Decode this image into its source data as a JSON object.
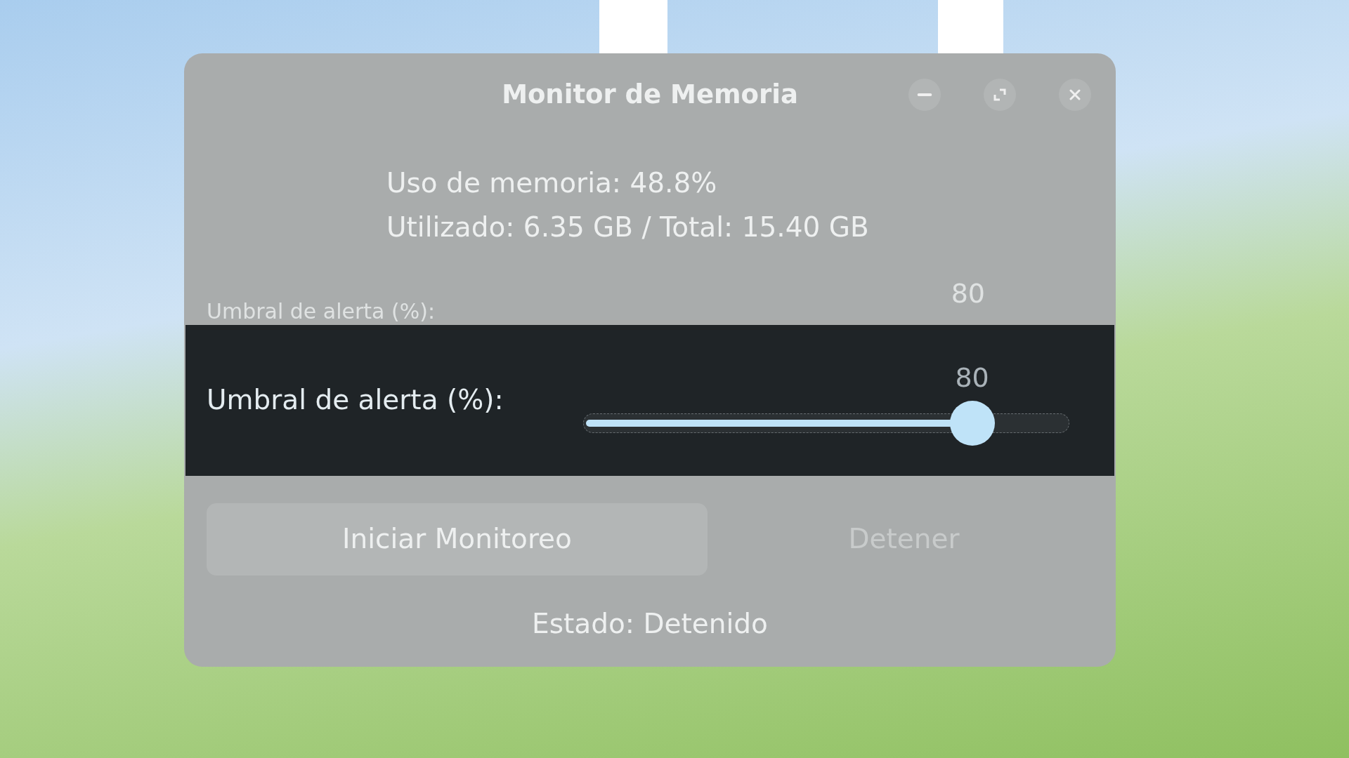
{
  "window": {
    "title": "Monitor de Memoria"
  },
  "memory": {
    "usage": "Uso de memoria: 48.8%",
    "detail": "Utilizado: 6.35 GB / Total: 15.40 GB"
  },
  "threshold_behind": {
    "label": "Umbral de alerta (%):",
    "value": "80"
  },
  "threshold": {
    "label": "Umbral de alerta (%):",
    "value": "80",
    "level": 0.8
  },
  "buttons": [
    {
      "label": "Iniciar Monitoreo",
      "disabled": false
    },
    {
      "label": "Detener",
      "disabled": true
    }
  ],
  "status": "Estado: Detenido"
}
